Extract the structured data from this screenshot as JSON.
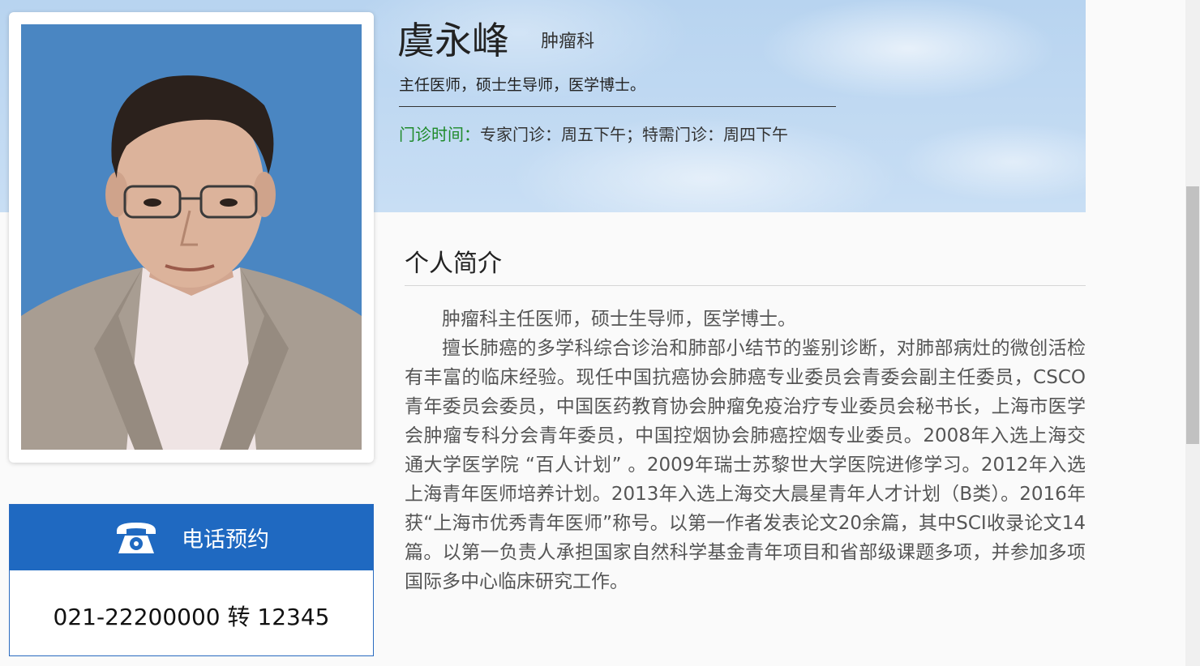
{
  "doctor": {
    "name": "虞永峰",
    "department": "肿瘤科",
    "title": "主任医师，硕士生导师，医学博士。",
    "clinic_label": "门诊时间：",
    "clinic_value": "专家门诊：周五下午；特需门诊：周四下午"
  },
  "profile": {
    "heading": "个人简介",
    "paragraphs": [
      "肿瘤科主任医师，硕士生导师，医学博士。",
      "擅长肺癌的多学科综合诊治和肺部小结节的鉴别诊断，对肺部病灶的微创活检有丰富的临床经验。现任中国抗癌协会肺癌专业委员会青委会副主任委员，CSCO青年委员会委员，中国医药教育协会肿瘤免疫治疗专业委员会秘书长，上海市医学会肿瘤专科分会青年委员，中国控烟协会肺癌控烟专业委员。2008年入选上海交通大学医学院 “百人计划” 。2009年瑞士苏黎世大学医院进修学习。2012年入选上海青年医师培养计划。2013年入选上海交大晨星青年人才计划（B类）。2016年获“上海市优秀青年医师”称号。以第一作者发表论文20余篇，其中SCI收录论文14篇。以第一负责人承担国家自然科学基金青年项目和省部级课题多项，并参加多项国际多中心临床研究工作。"
    ]
  },
  "booking": {
    "label": "电话预约",
    "icon": "telephone-icon",
    "phone": "021-22200000 转 12345"
  },
  "colors": {
    "accent_blue": "#1f69c1",
    "clinic_label_green": "#1e8a2a",
    "photo_background": "#4a86c2"
  }
}
